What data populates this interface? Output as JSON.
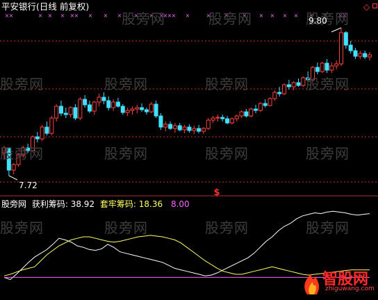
{
  "header": {
    "title": "平安银行(日线 前复权)",
    "title_color": "#ffffff"
  },
  "price_labels": {
    "high": "9.80",
    "low": "7.72"
  },
  "signal_marker": "$",
  "indicator": {
    "name": "股旁网",
    "items": [
      {
        "label": "获利筹码:",
        "value": "38.92",
        "color": "#ffffff"
      },
      {
        "label": "套牢筹码:",
        "value": "18.36",
        "color": "#ffff66"
      },
      {
        "label": "",
        "value": "8.00",
        "color": "#ff66ff"
      }
    ]
  },
  "watermark": "股旁网",
  "logo": {
    "text": "智股网",
    "url": "zhiguwang.com"
  },
  "colors": {
    "background": "#000000",
    "up": "#ff4040",
    "down": "#40e0ff",
    "profit_line": "#ffffff",
    "trapped_line": "#ffff66",
    "ref_line": "#ff66ff",
    "grid": "#c03030",
    "marker": "#ff66ff"
  },
  "chart_data": [
    {
      "type": "candlestick",
      "title": "平安银行(日线 前复权)",
      "ylim": [
        7.6,
        9.95
      ],
      "marked_high": 9.8,
      "marked_low": 7.72,
      "candles": [
        [
          8.05,
          8.15,
          7.95,
          8.12
        ],
        [
          8.12,
          8.1,
          7.72,
          7.8
        ],
        [
          7.8,
          7.9,
          7.74,
          7.88
        ],
        [
          7.88,
          8.05,
          7.85,
          8.02
        ],
        [
          8.02,
          8.15,
          7.98,
          8.12
        ],
        [
          8.12,
          8.18,
          8.05,
          8.08
        ],
        [
          8.08,
          8.3,
          8.06,
          8.28
        ],
        [
          8.28,
          8.35,
          8.2,
          8.25
        ],
        [
          8.25,
          8.45,
          8.22,
          8.42
        ],
        [
          8.42,
          8.5,
          8.3,
          8.33
        ],
        [
          8.33,
          8.58,
          8.3,
          8.55
        ],
        [
          8.55,
          8.75,
          8.5,
          8.72
        ],
        [
          8.72,
          8.8,
          8.58,
          8.62
        ],
        [
          8.62,
          8.7,
          8.55,
          8.6
        ],
        [
          8.6,
          8.72,
          8.56,
          8.7
        ],
        [
          8.7,
          8.75,
          8.52,
          8.55
        ],
        [
          8.55,
          8.85,
          8.52,
          8.82
        ],
        [
          8.82,
          8.88,
          8.7,
          8.74
        ],
        [
          8.74,
          8.8,
          8.62,
          8.65
        ],
        [
          8.65,
          8.8,
          8.6,
          8.78
        ],
        [
          8.78,
          8.9,
          8.72,
          8.85
        ],
        [
          8.85,
          8.92,
          8.75,
          8.8
        ],
        [
          8.8,
          8.86,
          8.66,
          8.7
        ],
        [
          8.7,
          8.82,
          8.65,
          8.78
        ],
        [
          8.78,
          8.84,
          8.7,
          8.72
        ],
        [
          8.72,
          8.75,
          8.6,
          8.63
        ],
        [
          8.63,
          8.7,
          8.58,
          8.66
        ],
        [
          8.66,
          8.72,
          8.6,
          8.68
        ],
        [
          8.68,
          8.74,
          8.62,
          8.7
        ],
        [
          8.7,
          8.76,
          8.64,
          8.67
        ],
        [
          8.67,
          8.7,
          8.6,
          8.64
        ],
        [
          8.64,
          8.78,
          8.62,
          8.75
        ],
        [
          8.75,
          8.8,
          8.55,
          8.58
        ],
        [
          8.58,
          8.62,
          8.38,
          8.42
        ],
        [
          8.42,
          8.5,
          8.36,
          8.46
        ],
        [
          8.46,
          8.5,
          8.38,
          8.4
        ],
        [
          8.4,
          8.48,
          8.34,
          8.44
        ],
        [
          8.44,
          8.48,
          8.36,
          8.38
        ],
        [
          8.38,
          8.45,
          8.33,
          8.42
        ],
        [
          8.42,
          8.46,
          8.34,
          8.37
        ],
        [
          8.37,
          8.44,
          8.32,
          8.4
        ],
        [
          8.4,
          8.45,
          8.33,
          8.36
        ],
        [
          8.36,
          8.42,
          8.32,
          8.4
        ],
        [
          8.4,
          8.55,
          8.38,
          8.52
        ],
        [
          8.52,
          8.58,
          8.48,
          8.55
        ],
        [
          8.55,
          8.6,
          8.5,
          8.56
        ],
        [
          8.56,
          8.6,
          8.5,
          8.54
        ],
        [
          8.54,
          8.58,
          8.46,
          8.48
        ],
        [
          8.48,
          8.56,
          8.46,
          8.54
        ],
        [
          8.54,
          8.6,
          8.5,
          8.58
        ],
        [
          8.58,
          8.66,
          8.55,
          8.64
        ],
        [
          8.64,
          8.68,
          8.56,
          8.58
        ],
        [
          8.58,
          8.7,
          8.56,
          8.68
        ],
        [
          8.68,
          8.74,
          8.62,
          8.66
        ],
        [
          8.66,
          8.78,
          8.64,
          8.76
        ],
        [
          8.76,
          8.82,
          8.7,
          8.73
        ],
        [
          8.73,
          8.85,
          8.72,
          8.83
        ],
        [
          8.83,
          8.95,
          8.8,
          8.92
        ],
        [
          8.92,
          9.0,
          8.86,
          8.9
        ],
        [
          8.9,
          9.05,
          8.88,
          9.03
        ],
        [
          9.03,
          9.1,
          8.96,
          9.0
        ],
        [
          9.0,
          9.08,
          8.95,
          9.06
        ],
        [
          9.06,
          9.12,
          9.0,
          9.02
        ],
        [
          9.02,
          9.15,
          9.0,
          9.13
        ],
        [
          9.13,
          9.22,
          9.08,
          9.1
        ],
        [
          9.1,
          9.3,
          9.08,
          9.28
        ],
        [
          9.28,
          9.35,
          9.18,
          9.22
        ],
        [
          9.22,
          9.36,
          9.2,
          9.34
        ],
        [
          9.34,
          9.4,
          9.2,
          9.24
        ],
        [
          9.24,
          9.35,
          9.2,
          9.3
        ],
        [
          9.3,
          9.38,
          9.25,
          9.33
        ],
        [
          9.33,
          9.85,
          9.3,
          9.78
        ],
        [
          9.78,
          9.8,
          9.55,
          9.6
        ],
        [
          9.6,
          9.66,
          9.48,
          9.52
        ],
        [
          9.52,
          9.56,
          9.4,
          9.44
        ],
        [
          9.44,
          9.52,
          9.4,
          9.48
        ],
        [
          9.48,
          9.52,
          9.4,
          9.43
        ],
        [
          9.43,
          9.5,
          9.38,
          9.46
        ]
      ]
    },
    {
      "type": "line",
      "series": [
        {
          "name": "获利筹码",
          "values": [
            8,
            5,
            12,
            20,
            28,
            35,
            40,
            45,
            52,
            60,
            58,
            55,
            50,
            48,
            45,
            44,
            46,
            52,
            48,
            42,
            40,
            38,
            36,
            34,
            32,
            30,
            28,
            24,
            20,
            18,
            16,
            14,
            12,
            10,
            11,
            14,
            18,
            22,
            26,
            30,
            34,
            40,
            48,
            56,
            62,
            70,
            76,
            80,
            86,
            90,
            92,
            94,
            93,
            95,
            96,
            95,
            94,
            92,
            91,
            92,
            93
          ]
        },
        {
          "name": "套牢筹码",
          "values": [
            10,
            12,
            15,
            18,
            20,
            22,
            30,
            38,
            44,
            50,
            54,
            58,
            60,
            62,
            62,
            60,
            58,
            56,
            55,
            56,
            58,
            60,
            62,
            63,
            64,
            63,
            62,
            60,
            58,
            54,
            48,
            42,
            36,
            30,
            25,
            20,
            16,
            14,
            12,
            12,
            14,
            16,
            18,
            20,
            22,
            20,
            18,
            16,
            14,
            12,
            11,
            12,
            13,
            14,
            15,
            16,
            17,
            18,
            18,
            18,
            18
          ]
        },
        {
          "name": "8.00",
          "values": [
            8,
            8,
            8,
            8,
            8,
            8,
            8,
            8,
            8,
            8,
            8,
            8,
            8,
            8,
            8,
            8,
            8,
            8,
            8,
            8,
            8,
            8,
            8,
            8,
            8,
            8,
            8,
            8,
            8,
            8,
            8,
            8,
            8,
            8,
            8,
            8,
            8,
            8,
            8,
            8,
            8,
            8,
            8,
            8,
            8,
            8,
            8,
            8,
            8,
            8,
            8,
            8,
            8,
            8,
            8,
            8,
            8,
            8,
            8,
            8,
            8
          ]
        }
      ],
      "ylim": [
        0,
        100
      ]
    }
  ]
}
